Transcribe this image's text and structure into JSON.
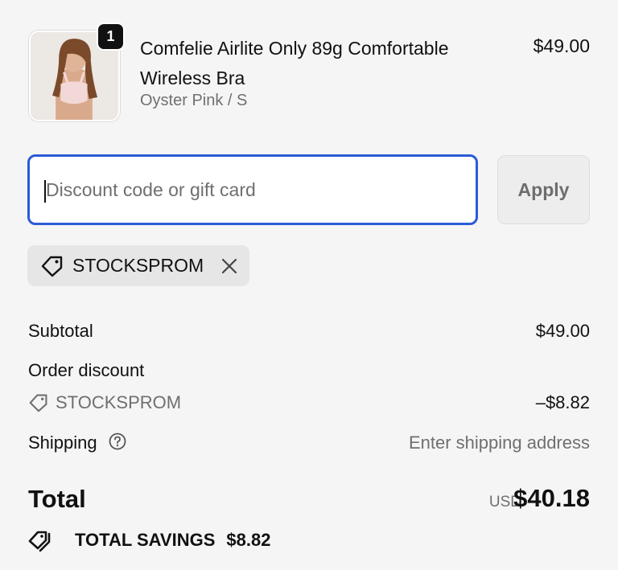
{
  "product": {
    "quantity": "1",
    "title": "Comfelie Airlite Only 89g Comfortable Wireless Bra",
    "variant": "Oyster Pink / S",
    "price": "$49.00",
    "image_icon": "product-photo"
  },
  "discount": {
    "placeholder": "Discount code or gift card",
    "value": "",
    "apply_label": "Apply"
  },
  "applied_code": {
    "code": "STOCKSPROM",
    "tag_icon": "tag-icon",
    "remove_icon": "close-icon"
  },
  "summary": {
    "subtotal_label": "Subtotal",
    "subtotal_value": "$49.00",
    "order_discount_label": "Order discount",
    "discount_code": "STOCKSPROM",
    "discount_value": "–$8.82",
    "shipping_label": "Shipping",
    "shipping_value": "Enter shipping address",
    "help_icon": "help-icon"
  },
  "total": {
    "label": "Total",
    "currency": "USD",
    "amount": "$40.18"
  },
  "savings": {
    "label": "TOTAL SAVINGS",
    "amount": "$8.82"
  },
  "colors": {
    "accent": "#2a5bd7",
    "background": "#f5f5f5",
    "muted_text": "#6f6f6f"
  }
}
